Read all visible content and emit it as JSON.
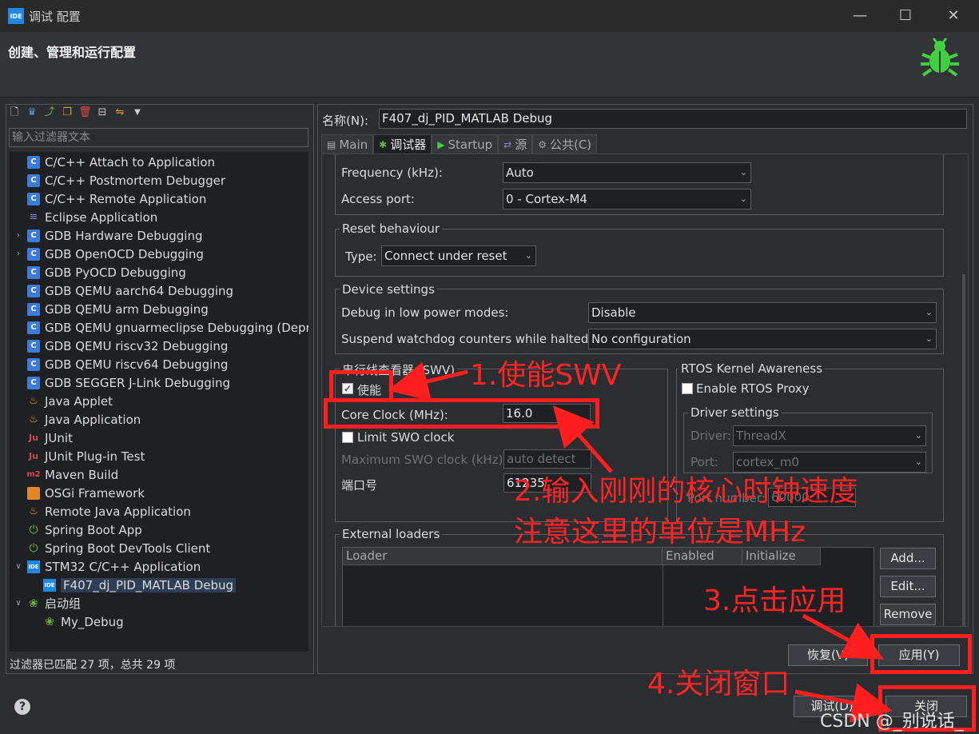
{
  "window": {
    "icon_text": "IDE",
    "title": "调试 配置",
    "header_title": "创建、管理和运行配置"
  },
  "left": {
    "filter_placeholder": "输入过滤器文本",
    "tree": [
      {
        "label": "C/C++ Attach to Application",
        "icon": "c-icon",
        "expandable": false,
        "indent": 0
      },
      {
        "label": "C/C++ Postmortem Debugger",
        "icon": "c-icon",
        "expandable": false,
        "indent": 0
      },
      {
        "label": "C/C++ Remote Application",
        "icon": "c-icon",
        "expandable": false,
        "indent": 0
      },
      {
        "label": "Eclipse Application",
        "icon": "eclipse-icon",
        "expandable": false,
        "indent": 0
      },
      {
        "label": "GDB Hardware Debugging",
        "icon": "c-icon",
        "expandable": true,
        "indent": 0
      },
      {
        "label": "GDB OpenOCD Debugging",
        "icon": "c-icon",
        "expandable": true,
        "indent": 0
      },
      {
        "label": "GDB PyOCD Debugging",
        "icon": "c-icon",
        "expandable": false,
        "indent": 0
      },
      {
        "label": "GDB QEMU aarch64 Debugging",
        "icon": "c-icon",
        "expandable": false,
        "indent": 0
      },
      {
        "label": "GDB QEMU arm Debugging",
        "icon": "c-icon",
        "expandable": false,
        "indent": 0
      },
      {
        "label": "GDB QEMU gnuarmeclipse Debugging (Depre",
        "icon": "c-icon",
        "expandable": false,
        "indent": 0
      },
      {
        "label": "GDB QEMU riscv32 Debugging",
        "icon": "c-icon",
        "expandable": false,
        "indent": 0
      },
      {
        "label": "GDB QEMU riscv64 Debugging",
        "icon": "c-icon",
        "expandable": false,
        "indent": 0
      },
      {
        "label": "GDB SEGGER J-Link Debugging",
        "icon": "c-icon",
        "expandable": false,
        "indent": 0
      },
      {
        "label": "Java Applet",
        "icon": "java-icon",
        "expandable": false,
        "indent": 0
      },
      {
        "label": "Java Application",
        "icon": "java-icon",
        "expandable": false,
        "indent": 0
      },
      {
        "label": "JUnit",
        "icon": "junit-icon",
        "expandable": false,
        "indent": 0
      },
      {
        "label": "JUnit Plug-in Test",
        "icon": "junit-icon",
        "expandable": false,
        "indent": 0
      },
      {
        "label": "Maven Build",
        "icon": "maven-icon",
        "expandable": false,
        "indent": 0
      },
      {
        "label": "OSGi Framework",
        "icon": "osgi-icon",
        "expandable": false,
        "indent": 0
      },
      {
        "label": "Remote Java Application",
        "icon": "java-icon",
        "expandable": false,
        "indent": 0
      },
      {
        "label": "Spring Boot App",
        "icon": "spring-icon",
        "expandable": false,
        "indent": 0
      },
      {
        "label": "Spring Boot DevTools Client",
        "icon": "spring-icon",
        "expandable": false,
        "indent": 0
      },
      {
        "label": "STM32 C/C++ Application",
        "icon": "ide-icon",
        "expandable": true,
        "expanded": true,
        "indent": 0
      },
      {
        "label": "F407_dj_PID_MATLAB Debug",
        "icon": "ide-icon",
        "expandable": false,
        "indent": 1,
        "selected": true
      },
      {
        "label": "启动组",
        "icon": "launch-group-icon",
        "expandable": true,
        "expanded": true,
        "indent": 0
      },
      {
        "label": "My_Debug",
        "icon": "launch-group-icon",
        "expandable": false,
        "indent": 1
      }
    ],
    "status": "过滤器已匹配 27 项，总共 29 项"
  },
  "right": {
    "name_label": "名称(N):",
    "name_value": "F407_dj_PID_MATLAB Debug",
    "tabs": [
      {
        "label": "Main",
        "icon": "main-icon",
        "active": false
      },
      {
        "label": "调试器",
        "icon": "debugger-icon",
        "active": true
      },
      {
        "label": "Startup",
        "icon": "startup-icon",
        "active": false
      },
      {
        "label": "源",
        "icon": "source-icon",
        "active": false
      },
      {
        "label": "公共(C)",
        "icon": "common-icon",
        "active": false
      }
    ],
    "frequency_label": "Frequency (kHz):",
    "frequency_value": "Auto",
    "access_port_label": "Access port:",
    "access_port_value": "0 - Cortex-M4",
    "reset_group": "Reset behaviour",
    "reset_type_label": "Type:",
    "reset_type_value": "Connect under reset",
    "device_group": "Device settings",
    "low_power_label": "Debug in low power modes:",
    "low_power_value": "Disable",
    "watchdog_label": "Suspend watchdog counters while halted:",
    "watchdog_value": "No configuration",
    "swv_group": "串行线查看器 (SWV)",
    "swv_enable_label": "使能",
    "swv_enable_checked": true,
    "core_clock_label": "Core Clock (MHz):",
    "core_clock_value": "16.0",
    "limit_swo_label": "Limit SWO clock",
    "limit_swo_checked": false,
    "max_swo_label": "Maximum SWO clock (kHz):",
    "max_swo_value": "auto detect",
    "port_label": "端口号",
    "port_value": "61235",
    "rtos_group": "RTOS Kernel Awareness",
    "rtos_enable_label": "Enable RTOS Proxy",
    "rtos_enable_checked": false,
    "driver_group": "Driver settings",
    "driver_label": "Driver:",
    "driver_value": "ThreadX",
    "rtos_port_label": "Port:",
    "rtos_port_value": "cortex_m0",
    "port_number_label": "Port number:",
    "port_number_value": "60000",
    "ext_group": "External loaders",
    "ext_columns": [
      "Loader",
      "Enabled",
      "Initialize"
    ],
    "add_button": "Add...",
    "edit_button": "Edit...",
    "remove_button": "Remove",
    "revert_button": "恢复(V)",
    "apply_button": "应用(Y)"
  },
  "footer": {
    "debug_button": "调试(D)",
    "close_button": "关闭"
  },
  "annotations": {
    "step1": "1.使能SWV",
    "step2_line1": "2.输入刚刚的核心时钟速度",
    "step2_line2": "注意这里的单位是MHz",
    "step3": "3.点击应用",
    "step4": "4.关闭窗口",
    "watermark": "CSDN @_别说话_"
  },
  "colors": {
    "annotation_red": "#ff1f1f",
    "bug_green": "#3fd13f",
    "selection": "#2f3e55"
  }
}
